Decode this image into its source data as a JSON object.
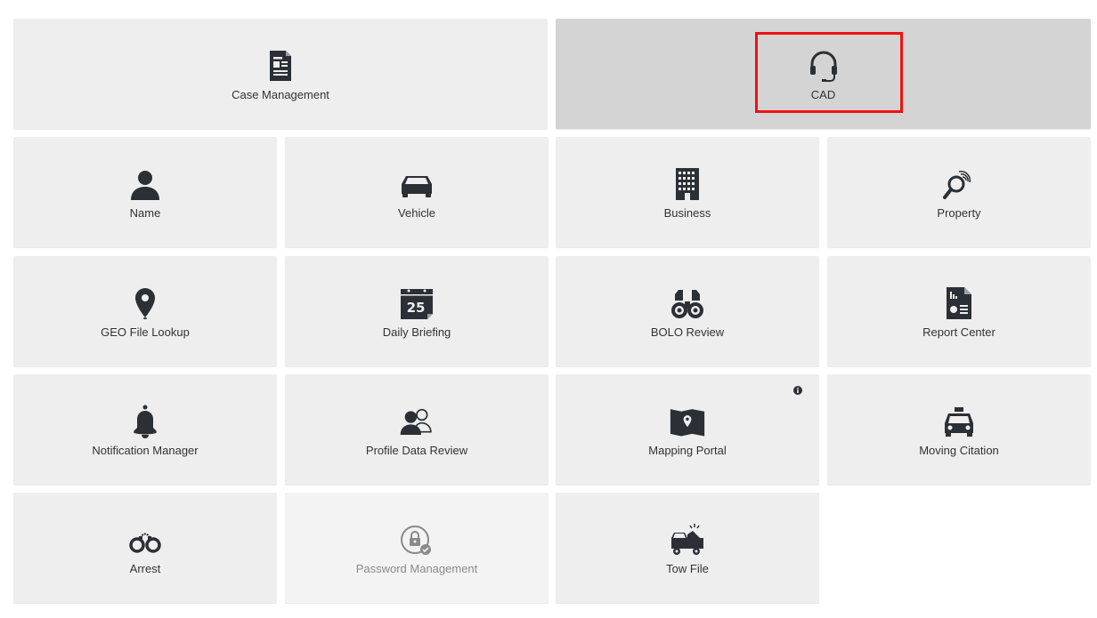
{
  "colors": {
    "icon": "#2b3036",
    "tile_bg": "#eeeeee",
    "tile_active_bg": "#d4d4d4",
    "highlight": "#ee1111",
    "label": "#333333",
    "disabled_label": "#8a8a8a"
  },
  "tiles": [
    {
      "label": "Case Management",
      "icon": "document-icon"
    },
    {
      "label": "CAD",
      "icon": "headset-icon",
      "state": "selected"
    },
    {
      "label": "Name",
      "icon": "person-icon"
    },
    {
      "label": "Vehicle",
      "icon": "car-icon"
    },
    {
      "label": "Business",
      "icon": "building-icon"
    },
    {
      "label": "Property",
      "icon": "fingerprint-magnifier-icon"
    },
    {
      "label": "GEO File Lookup",
      "icon": "map-pin-icon"
    },
    {
      "label": "Daily Briefing",
      "icon": "calendar-icon",
      "icon_text": "25"
    },
    {
      "label": "BOLO Review",
      "icon": "binoculars-icon"
    },
    {
      "label": "Report Center",
      "icon": "report-icon"
    },
    {
      "label": "Notification Manager",
      "icon": "bell-icon"
    },
    {
      "label": "Profile Data Review",
      "icon": "users-icon"
    },
    {
      "label": "Mapping Portal",
      "icon": "map-icon",
      "has_info": true
    },
    {
      "label": "Moving Citation",
      "icon": "taxi-icon"
    },
    {
      "label": "Arrest",
      "icon": "handcuffs-icon"
    },
    {
      "label": "Password Management",
      "icon": "lock-icon",
      "state": "disabled"
    },
    {
      "label": "Tow File",
      "icon": "tow-truck-icon"
    }
  ]
}
